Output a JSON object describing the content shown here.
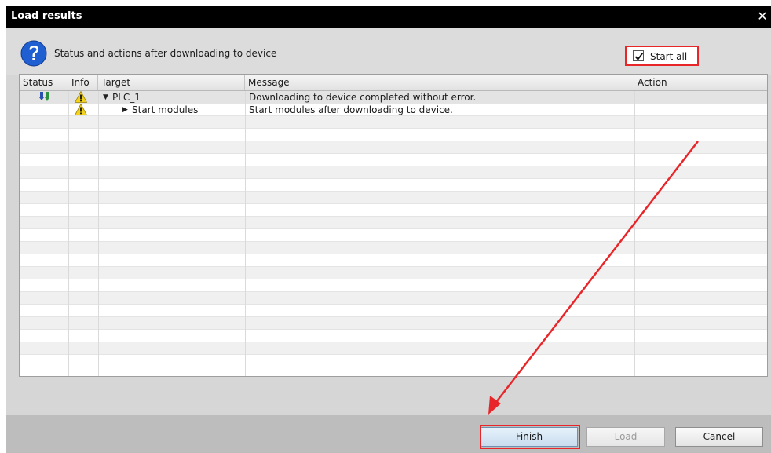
{
  "dialog": {
    "title": "Load results",
    "close_glyph": "✕",
    "header_text": "Status and actions after downloading to device",
    "header_icon": "question-icon"
  },
  "table": {
    "columns": [
      "Status",
      "Info",
      "Target",
      "Message",
      "Action"
    ],
    "rows": [
      {
        "status_icon": "download-icon",
        "info_icon": "warning-icon",
        "expander": "▼",
        "target": "PLC_1",
        "message": "Downloading to device completed without error.",
        "action": ""
      },
      {
        "status_icon": "",
        "info_icon": "warning-icon",
        "expander": "▶",
        "target": "Start modules",
        "message": "Start modules after downloading to device.",
        "action_checkbox_checked": true,
        "action": "Start all"
      }
    ]
  },
  "buttons": {
    "finish": "Finish",
    "load": "Load",
    "cancel": "Cancel"
  },
  "colors": {
    "highlight_red": "#e8262a",
    "question_blue": "#1f5fd1",
    "warning_yellow": "#f2d21b",
    "status_green": "#2e8f3e",
    "status_blue": "#2a4fb0"
  }
}
